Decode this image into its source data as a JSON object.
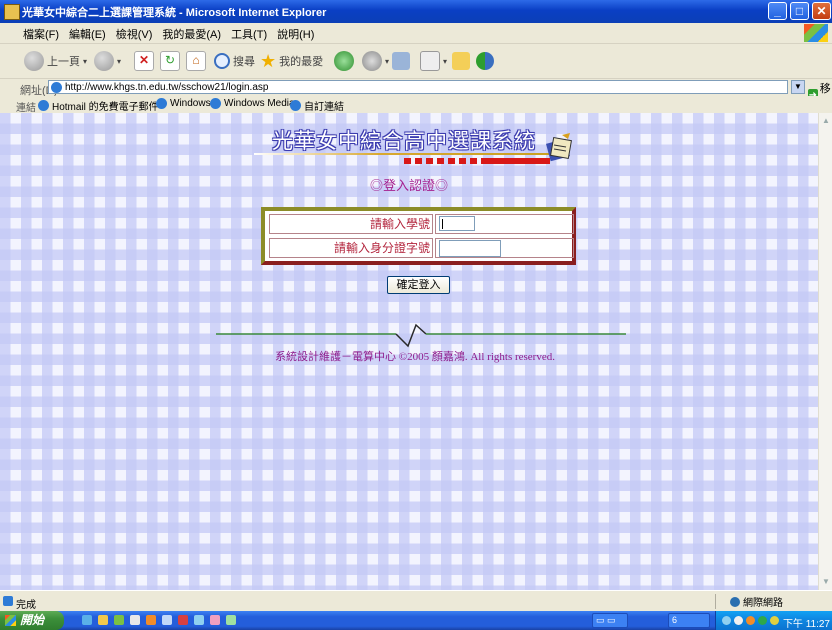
{
  "window": {
    "title": "光華女中綜合二上選課管理系統 - Microsoft Internet Explorer"
  },
  "menu": [
    "檔案(F)",
    "編輯(E)",
    "檢視(V)",
    "我的最愛(A)",
    "工具(T)",
    "說明(H)"
  ],
  "toolbar": {
    "back_label": "上一頁",
    "search_label": "搜尋",
    "favorites_label": "我的最愛"
  },
  "address": {
    "label": "網址(D)",
    "url": "http://www.khgs.tn.edu.tw/sschow21/login.asp",
    "go_label": "移至"
  },
  "links": {
    "label": "連結",
    "items": [
      "Hotmail 的免費電子郵件",
      "Windows",
      "Windows Media",
      "自訂連結"
    ]
  },
  "page": {
    "banner_title": "光華女中綜合高中選課系統",
    "heading": "◎登入認證◎",
    "form": {
      "student_id_label": "請輸入學號",
      "student_id_value": "",
      "id_card_label": "請輸入身分證字號",
      "id_card_value": ""
    },
    "submit_label": "確定登入",
    "footer": "系統設計維護－電算中心 ©2005 顏嘉鴻. All rights reserved."
  },
  "status": {
    "text": "完成",
    "zone": "網際網路"
  },
  "taskbar": {
    "start_label": "開始",
    "clock": "下午 11:27",
    "tray_item": "6"
  },
  "colors": {
    "title_bar": "#0a3fc4",
    "heading": "#a51f8e",
    "label_red": "#b3263e",
    "footer": "#8e1b8c",
    "check_light": "#f3f4fe",
    "check_dark": "#c4caf6"
  }
}
